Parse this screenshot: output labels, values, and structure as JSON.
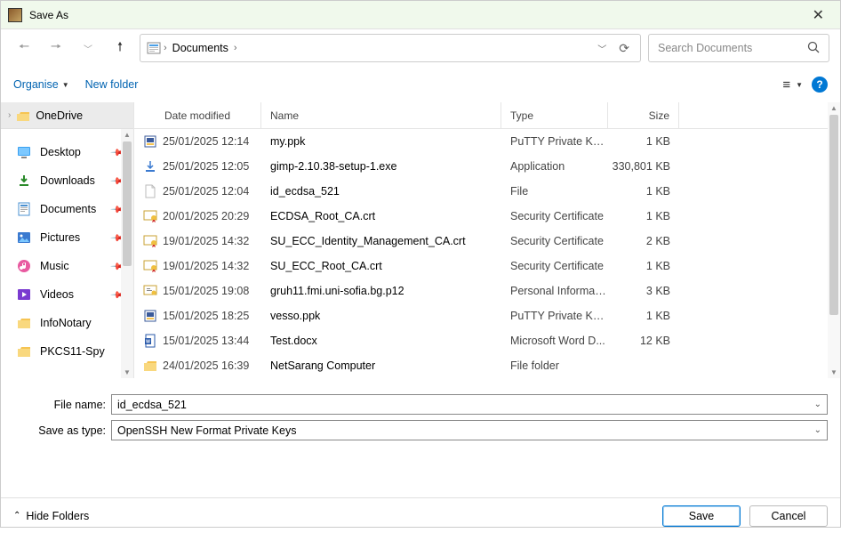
{
  "window": {
    "title": "Save As"
  },
  "nav": {
    "breadcrumb": "Documents"
  },
  "search": {
    "placeholder": "Search Documents"
  },
  "toolbar": {
    "organise": "Organise",
    "new_folder": "New folder"
  },
  "sidebar": {
    "top": "OneDrive",
    "items": [
      {
        "icon": "desktop",
        "label": "Desktop",
        "pinned": true
      },
      {
        "icon": "downloads",
        "label": "Downloads",
        "pinned": true
      },
      {
        "icon": "documents",
        "label": "Documents",
        "pinned": true
      },
      {
        "icon": "pictures",
        "label": "Pictures",
        "pinned": true
      },
      {
        "icon": "music",
        "label": "Music",
        "pinned": true
      },
      {
        "icon": "videos",
        "label": "Videos",
        "pinned": true
      },
      {
        "icon": "folder",
        "label": "InfoNotary",
        "pinned": false
      },
      {
        "icon": "folder",
        "label": "PKCS11-Spy",
        "pinned": false
      }
    ]
  },
  "columns": {
    "date": "Date modified",
    "name": "Name",
    "type": "Type",
    "size": "Size"
  },
  "files": [
    {
      "date": "25/01/2025 12:14",
      "name": "my.ppk",
      "type": "PuTTY Private Key...",
      "size": "1 KB",
      "icon": "ppk"
    },
    {
      "date": "25/01/2025 12:05",
      "name": "gimp-2.10.38-setup-1.exe",
      "type": "Application",
      "size": "330,801 KB",
      "icon": "exe"
    },
    {
      "date": "25/01/2025 12:04",
      "name": "id_ecdsa_521",
      "type": "File",
      "size": "1 KB",
      "icon": "blank"
    },
    {
      "date": "20/01/2025 20:29",
      "name": "ECDSA_Root_CA.crt",
      "type": "Security Certificate",
      "size": "1 KB",
      "icon": "cert"
    },
    {
      "date": "19/01/2025 14:32",
      "name": "SU_ECC_Identity_Management_CA.crt",
      "type": "Security Certificate",
      "size": "2 KB",
      "icon": "cert"
    },
    {
      "date": "19/01/2025 14:32",
      "name": "SU_ECC_Root_CA.crt",
      "type": "Security Certificate",
      "size": "1 KB",
      "icon": "cert"
    },
    {
      "date": "15/01/2025 19:08",
      "name": "gruh11.fmi.uni-sofia.bg.p12",
      "type": "Personal Informati...",
      "size": "3 KB",
      "icon": "p12"
    },
    {
      "date": "15/01/2025 18:25",
      "name": "vesso.ppk",
      "type": "PuTTY Private Key...",
      "size": "1 KB",
      "icon": "ppk"
    },
    {
      "date": "15/01/2025 13:44",
      "name": "Test.docx",
      "type": "Microsoft Word D...",
      "size": "12 KB",
      "icon": "docx"
    },
    {
      "date": "24/01/2025 16:39",
      "name": "NetSarang Computer",
      "type": "File folder",
      "size": "",
      "icon": "folder"
    }
  ],
  "form": {
    "filename_label": "File name:",
    "filename_value": "id_ecdsa_521",
    "savetype_label": "Save as type:",
    "savetype_value": "OpenSSH New Format Private Keys"
  },
  "footer": {
    "hide": "Hide Folders",
    "save": "Save",
    "cancel": "Cancel"
  }
}
